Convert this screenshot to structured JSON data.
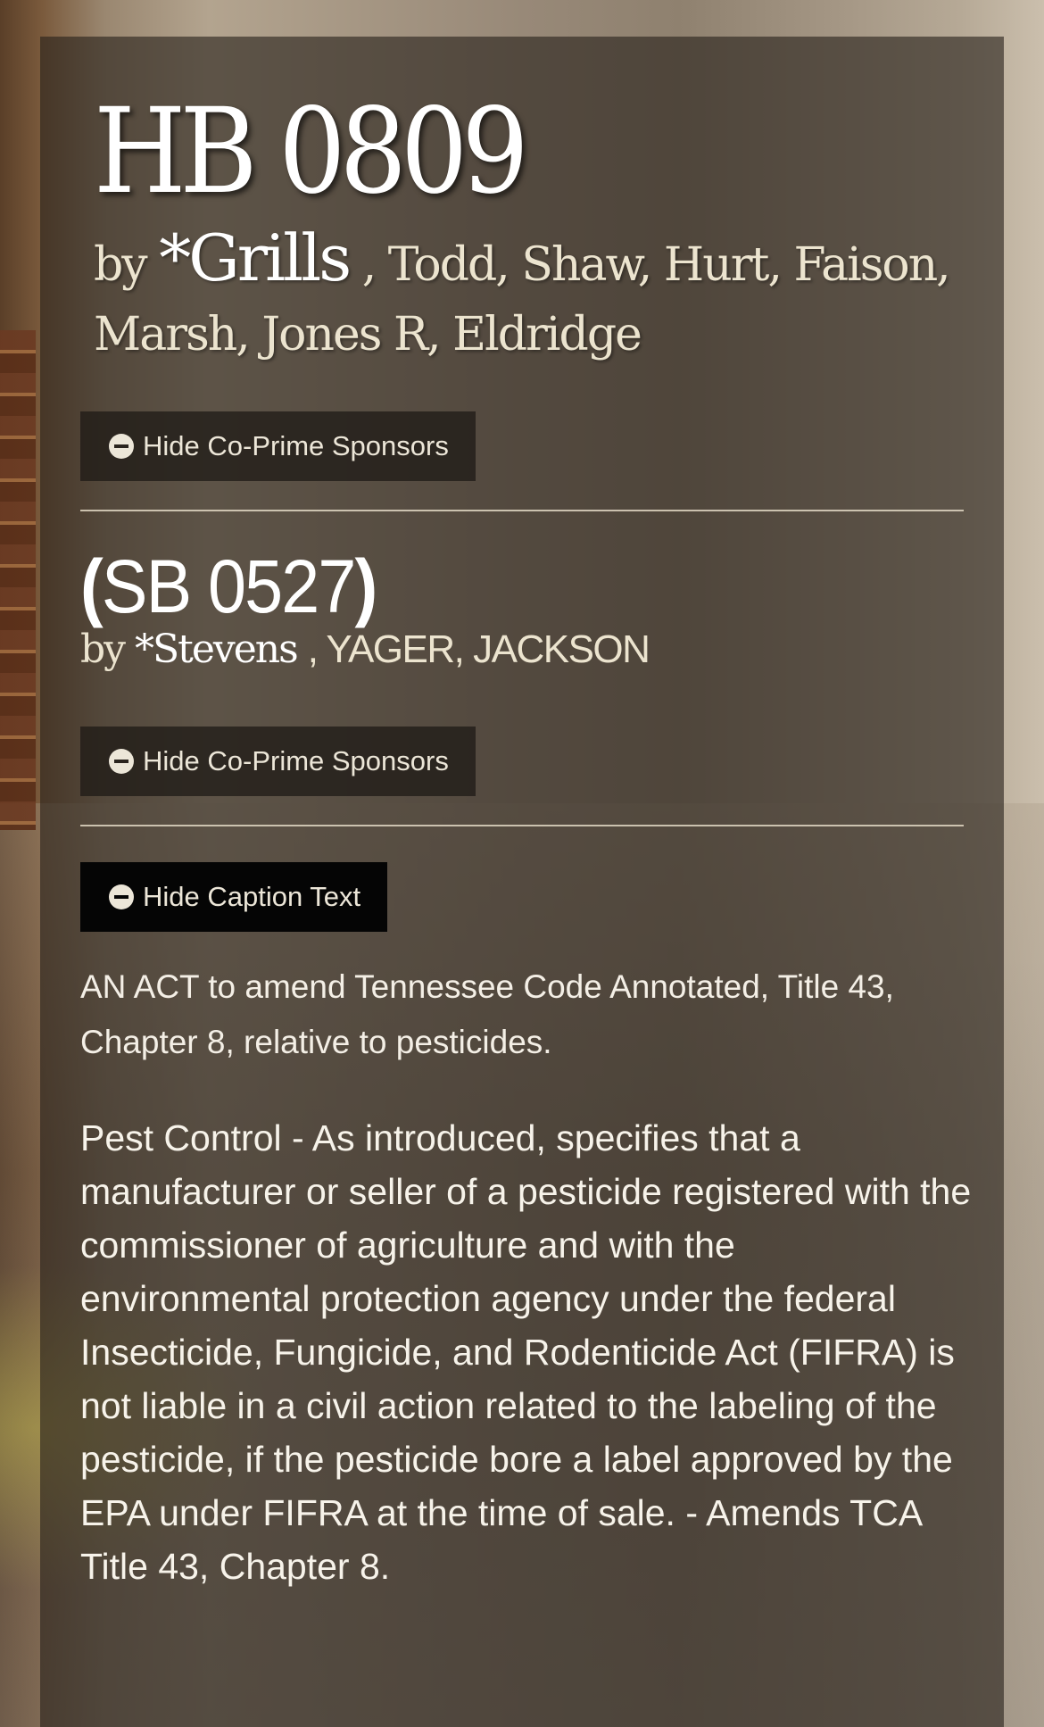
{
  "bill": {
    "number": "HB 0809",
    "sponsor_prefix": "by",
    "prime_sponsor": "*Grills",
    "co_sponsors": ", Todd, Shaw, Hurt, Faison, Marsh, Jones R, Eldridge",
    "toggle_label": "Hide Co-Prime Sponsors"
  },
  "companion": {
    "open_paren": "(",
    "number": "SB 0527",
    "close_paren": ")",
    "sponsor_prefix": "by",
    "prime_sponsor": "*Stevens",
    "co_sponsors": ", YAGER, JACKSON",
    "toggle_label": "Hide Co-Prime Sponsors"
  },
  "caption_toggle_label": "Hide Caption Text",
  "caption": "AN ACT to amend Tennessee Code Annotated, Title 43, Chapter 8, relative to pesticides.",
  "summary": "Pest Control - As introduced, specifies that a manufacturer or seller of a pesticide registered with the commissioner of agriculture and with the environmental protection agency under the federal Insecticide, Fungicide, and Rodenticide Act (FIFRA) is not liable in a civil action related to the labeling of the pesticide, if the pesticide bore a label approved by the EPA under FIFRA at the time of sale. - Amends TCA Title 43, Chapter 8.",
  "colors": {
    "panel": "#28221c",
    "cream_text": "#ece4cf",
    "button_dark": "#050505"
  },
  "icons": {
    "toggle": "minus-circle-icon"
  }
}
